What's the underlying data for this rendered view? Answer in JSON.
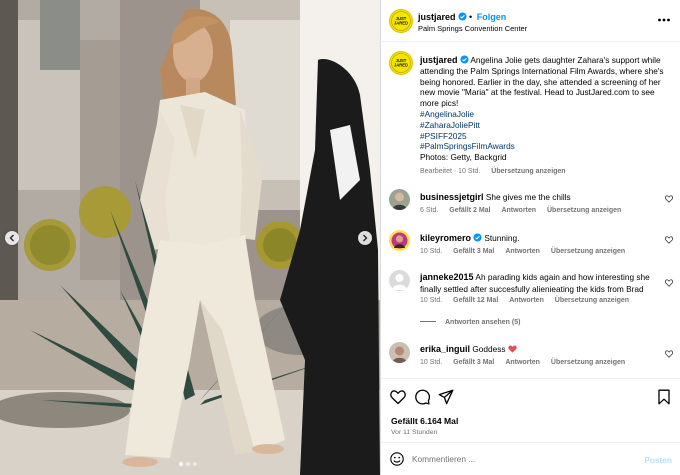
{
  "post": {
    "image_alt": "Photo of Angelina Jolie in a cream suit walking past desert plants",
    "carousel_slide_count": 3,
    "carousel_active_index": 0
  },
  "header": {
    "username": "justjared",
    "follow_label": "Folgen",
    "location": "Palm Springs Convention Center",
    "logo_text": "JUST JARED"
  },
  "caption": {
    "username": "justjared",
    "text": "Angelina Jolie gets daughter Zahara's support while attending the Palm Springs International Film Awards, where she's being honored. Earlier in the day, she attended a screening of her new movie \"Maria\" at the festival. Head to JustJared.com to see more pics!",
    "hashtags": [
      "#AngelinaJolie",
      "#ZaharaJoliePitt",
      "#PSIFF2025",
      "#PalmSpringsFilmAwards"
    ],
    "credits": "Photos: Getty, Backgrid",
    "edited": "Bearbeitet",
    "age": "10 Std.",
    "translate": "Übersetzung anzeigen"
  },
  "comments": [
    {
      "username": "businessjetgirl",
      "text": "She gives me the chills",
      "age": "6 Std.",
      "likes": "Gefällt 2 Mal",
      "reply": "Antworten",
      "translate": "Übersetzung anzeigen"
    },
    {
      "username": "kileyromero",
      "text": "Stunning.",
      "age": "10 Std.",
      "likes": "Gefällt 3 Mal",
      "reply": "Antworten",
      "translate": "Übersetzung anzeigen"
    },
    {
      "username": "janneke2015",
      "text": "Ah parading kids again and how interesting she finally settled after succesfully alienieating the kids from Brad",
      "age": "10 Std.",
      "likes": "Gefällt 12 Mal",
      "reply": "Antworten",
      "translate": "Übersetzung anzeigen"
    },
    {
      "username": "erika_inguil",
      "text": "Goddess",
      "age": "10 Std.",
      "likes": "Gefällt 3 Mal",
      "reply": "Antworten",
      "translate": "Übersetzung anzeigen"
    }
  ],
  "view_replies": "Antworten ansehen (5)",
  "actions": {
    "likes": "Gefällt 6.164 Mal",
    "time": "Vor 11 Stunden"
  },
  "composer": {
    "placeholder": "Kommentieren ...",
    "post_label": "Posten"
  },
  "icons": {
    "like": "heart-icon",
    "comment": "comment-icon",
    "share": "share-icon",
    "save": "bookmark-icon",
    "emoji": "emoji-icon",
    "more": "more-options-icon",
    "verified": "verified-badge-icon"
  },
  "colors": {
    "accent": "#0095f6",
    "link": "#00376b",
    "muted": "#737373",
    "emoji_heart": "#ed4956",
    "logo_bg": "#f5e400"
  }
}
